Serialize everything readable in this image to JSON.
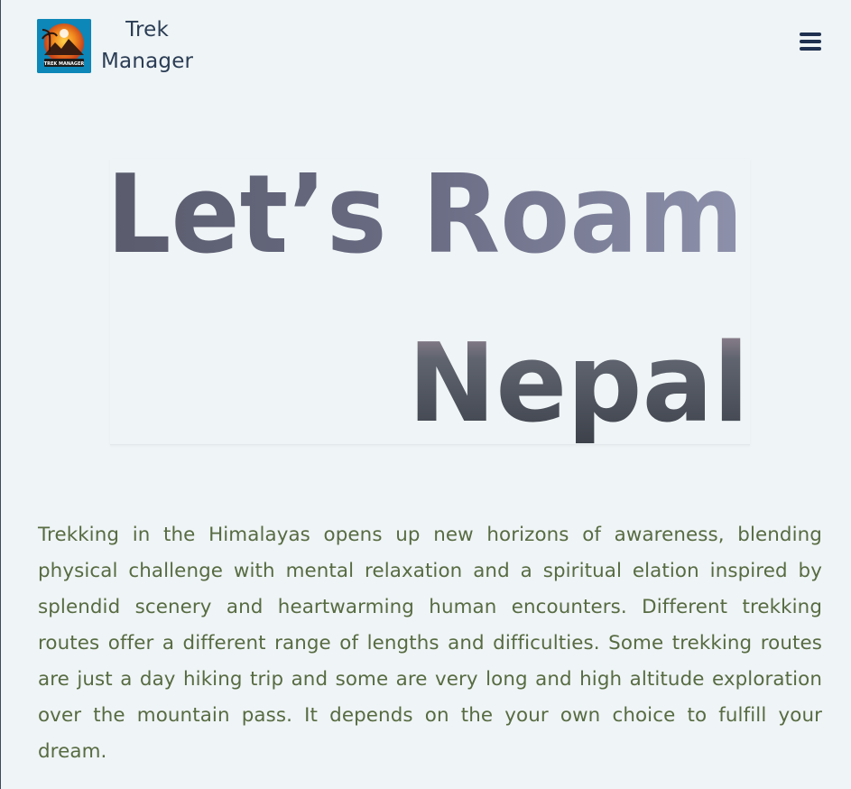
{
  "header": {
    "brand_line1": "Trek",
    "brand_line2": "Manager",
    "logo_text": "TREK MANAGER",
    "menu_icon": "hamburger-icon"
  },
  "hero": {
    "line1": "Let’s Roam",
    "line2": "Nepal"
  },
  "main": {
    "description": "Trekking in the Himalayas opens up new horizons of awareness, blending physical challenge with mental relaxation and a spiritual elation inspired by splendid scenery and heartwarming human encounters. Different trekking routes offer a different range of lengths and difficulties. Some trekking routes are just a day hiking trip and some are very long and high altitude exploration over the mountain pass. It depends on the your own choice to fulfill your dream."
  },
  "colors": {
    "background": "#eff4f6",
    "nav_text": "#2b3d55",
    "body_text": "#576b42",
    "hero_text_start": "#5f6175",
    "hero_text_end": "#8b8ea8"
  }
}
